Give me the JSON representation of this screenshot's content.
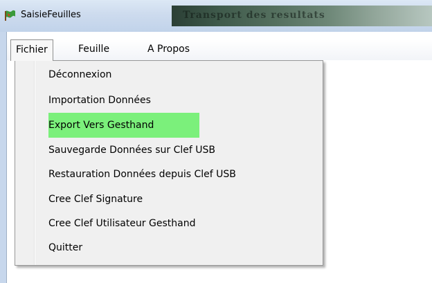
{
  "window": {
    "title": "SaisieFeuilles",
    "banner_text": "Transport des resultats",
    "icon": "app-flag-icon"
  },
  "menubar": {
    "items": [
      {
        "label": "Fichier",
        "state": "open"
      },
      {
        "label": "Feuille"
      },
      {
        "label": "A Propos"
      }
    ]
  },
  "dropdown": {
    "items": [
      {
        "label": "Déconnexion"
      },
      {
        "label": "Importation Données"
      },
      {
        "label": "Export Vers Gesthand",
        "highlighted": true
      },
      {
        "label": "Sauvegarde Données sur Clef USB"
      },
      {
        "label": "Restauration Données depuis Clef USB"
      },
      {
        "label": "Cree Clef Signature"
      },
      {
        "label": "Cree Clef Utilisateur Gesthand"
      },
      {
        "label": "Quitter"
      }
    ],
    "highlight_color": "#7bf07b"
  }
}
